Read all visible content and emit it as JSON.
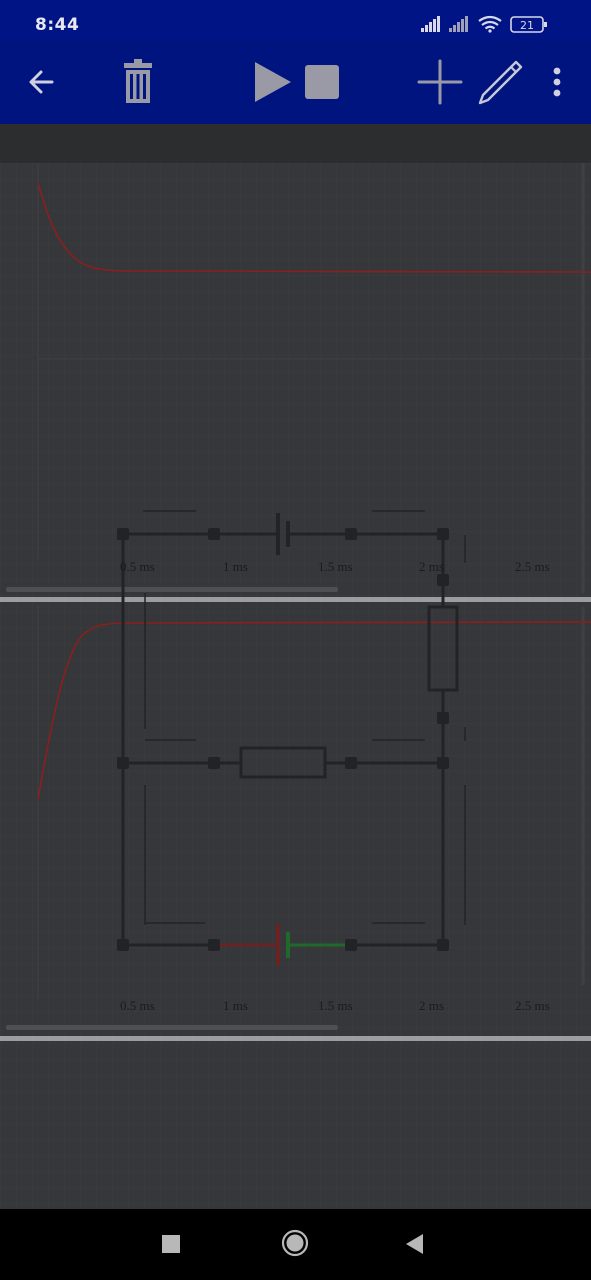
{
  "status_bar": {
    "time": "8:44",
    "battery": "21",
    "icons": [
      "signal-icon",
      "signal-icon",
      "wifi-icon",
      "battery-icon"
    ]
  },
  "toolbar": {
    "icons": [
      "back-arrow-icon",
      "trash-icon",
      "play-icon",
      "stop-icon",
      "add-icon",
      "pencil-icon",
      "more-vert-icon"
    ]
  },
  "scopes": [
    {
      "ticks": [
        "0.5 ms",
        "1 ms",
        "1.5 ms",
        "2 ms",
        "2.5 ms"
      ],
      "trace_color": "#8a1f1f"
    },
    {
      "ticks": [
        "0.5 ms",
        "1 ms",
        "1.5 ms",
        "2 ms",
        "2.5 ms"
      ],
      "trace_color": "#8a1f1f"
    }
  ],
  "nav_bar": {
    "icons": [
      "recents-square-icon",
      "home-circle-icon",
      "back-triangle-icon"
    ]
  },
  "colors": {
    "status_bar": "#001486",
    "toolbar": "#001480",
    "canvas": "#36373a",
    "wire": "#242527",
    "trace": "#8a1f1f",
    "highlight_green": "#1f6a2a"
  }
}
